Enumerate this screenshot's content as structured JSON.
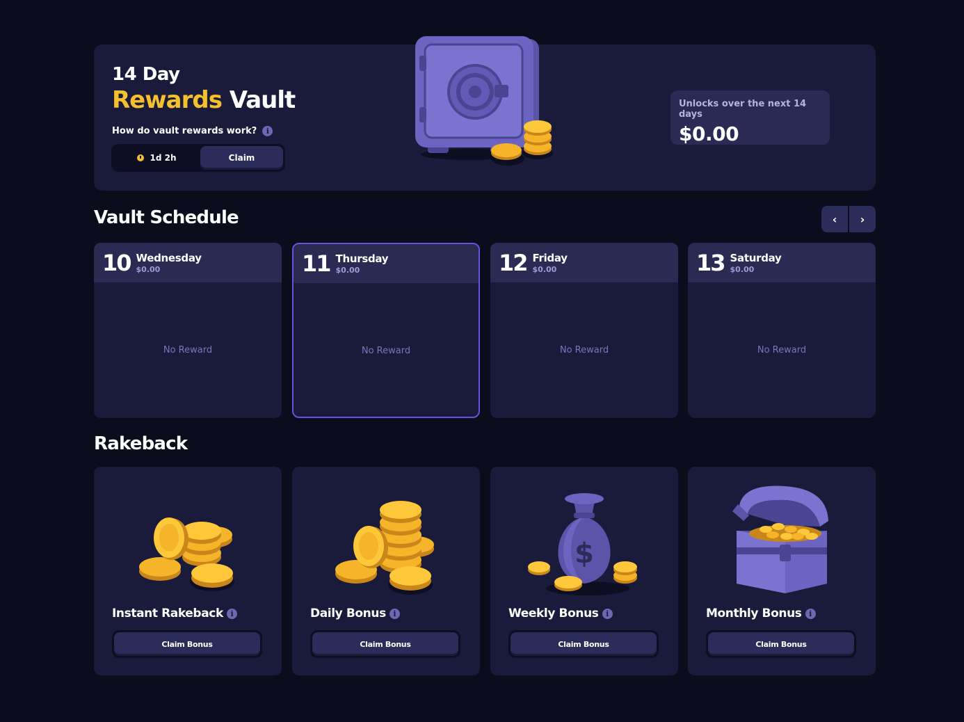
{
  "hero": {
    "title_small": "14 Day",
    "title_accent": "Rewards",
    "title_rest": "Vault",
    "help_text": "How do vault rewards work?",
    "timer": "1d 2h",
    "claim_label": "Claim",
    "unlock_label": "Unlocks over the next 14 days",
    "unlock_value": "$0.00",
    "accent_color": "#f5c02e"
  },
  "schedule": {
    "title": "Vault Schedule",
    "prev_icon": "chevron-left-icon",
    "next_icon": "chevron-right-icon",
    "days": [
      {
        "num": "10",
        "name": "Wednesday",
        "amount": "$0.00",
        "status": "No Reward"
      },
      {
        "num": "11",
        "name": "Thursday",
        "amount": "$0.00",
        "status": "No Reward",
        "active": true
      },
      {
        "num": "12",
        "name": "Friday",
        "amount": "$0.00",
        "status": "No Reward"
      },
      {
        "num": "13",
        "name": "Saturday",
        "amount": "$0.00",
        "status": "No Reward"
      }
    ]
  },
  "rakeback": {
    "title": "Rakeback",
    "cards": [
      {
        "label": "Instant Rakeback",
        "button": "Claim Bonus",
        "icon": "coins-icon"
      },
      {
        "label": "Daily Bonus",
        "button": "Claim Bonus",
        "icon": "coin-stack-icon"
      },
      {
        "label": "Weekly Bonus",
        "button": "Claim Bonus",
        "icon": "money-bag-icon"
      },
      {
        "label": "Monthly Bonus",
        "button": "Claim Bonus",
        "icon": "treasure-chest-icon"
      }
    ]
  }
}
